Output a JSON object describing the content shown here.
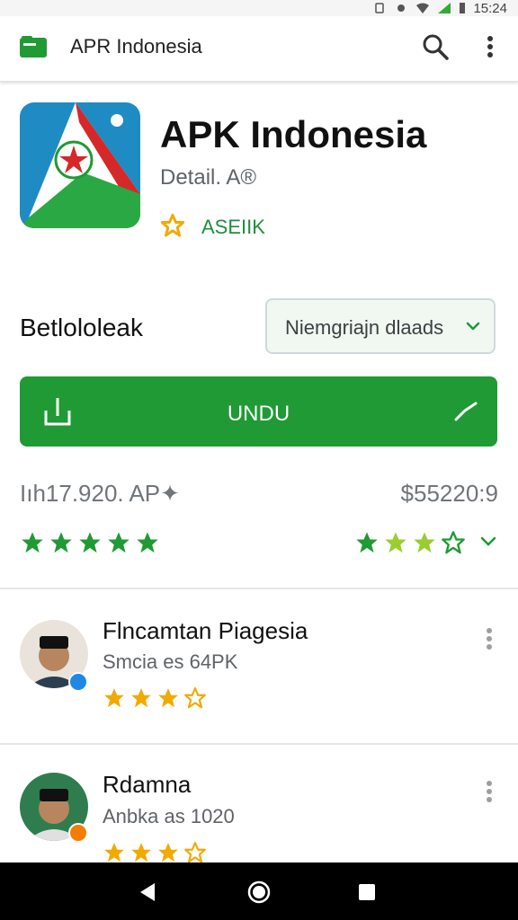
{
  "status_bar": {
    "time": "15:24"
  },
  "app_bar": {
    "title": "APR Indonesia"
  },
  "app": {
    "name": "APK Indonesia",
    "subtitle": "Detail. A®",
    "badge": "ASEIIK",
    "accent_color": "#1f9a34",
    "icons": {
      "app": "flag-triangle-icon",
      "badge": "star-icon"
    }
  },
  "section": {
    "label": "Betlololeak",
    "dropdown_value": "Niemgriajn dlaads"
  },
  "download_button": {
    "label": "UNDU"
  },
  "stats": {
    "left": "Iıh17.920. AP✦",
    "right": "$55220:9",
    "left_rating": 5,
    "right_rating": 3
  },
  "reviews": [
    {
      "name": "Flncamtan Piagesia",
      "subtitle": "Smcia  es 64PK",
      "rating": 3
    },
    {
      "name": "Rdamna",
      "subtitle": "Anbka as 1020",
      "rating": 3
    }
  ],
  "nav": {
    "icons": [
      "back-icon",
      "home-icon",
      "recents-icon"
    ]
  }
}
